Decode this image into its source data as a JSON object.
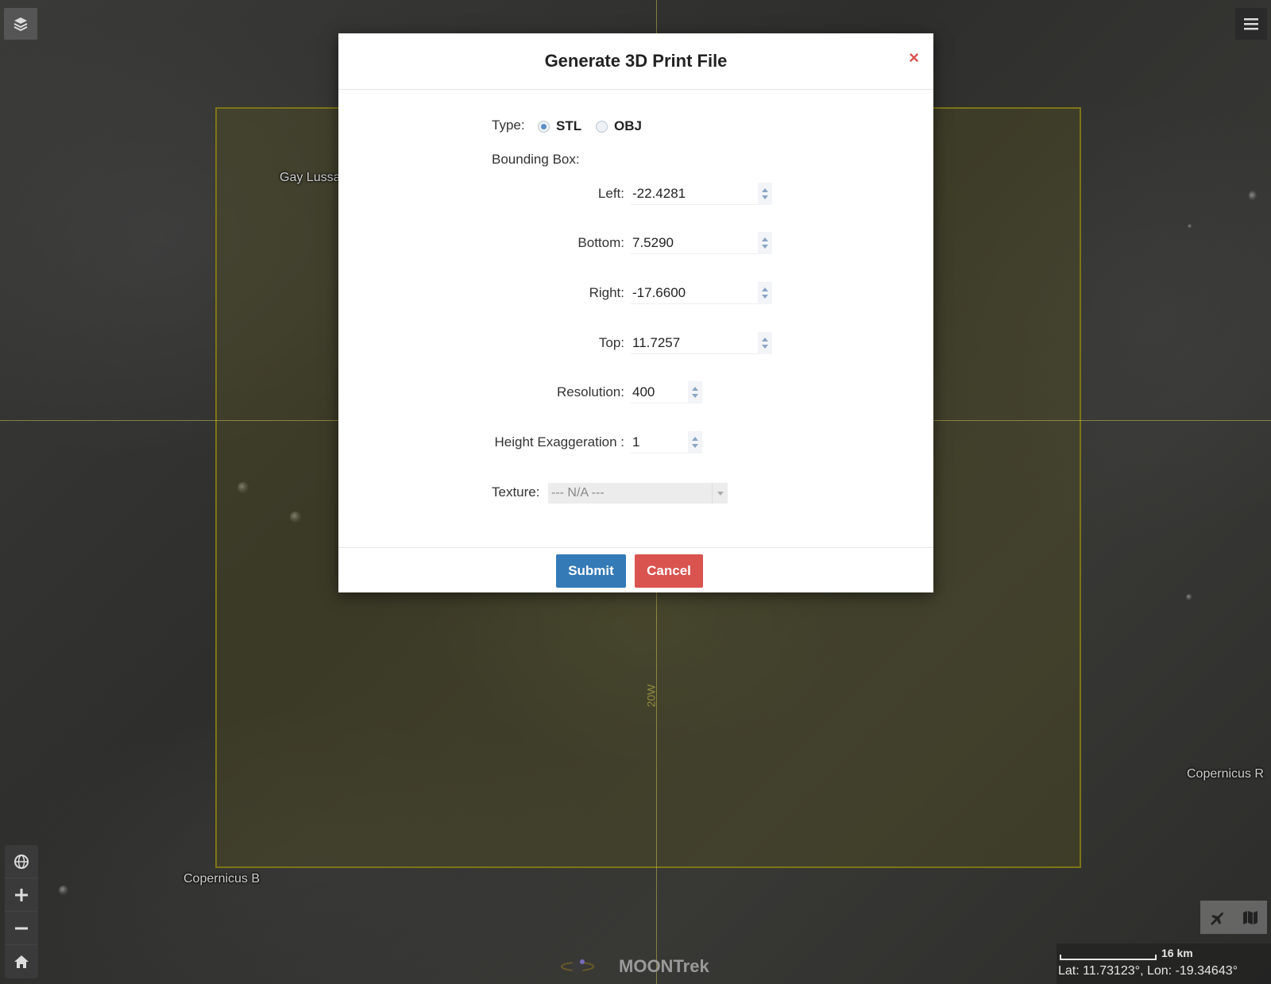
{
  "map": {
    "labels": {
      "gay_lussac": "Gay Lussac",
      "copernicus_b": "Copernicus B",
      "copernicus_r": "Copernicus R",
      "grid_lon": "20W"
    },
    "scale": {
      "text": "16 km"
    },
    "coords": "Lat: 11.73123°, Lon: -19.34643°",
    "logo": "MOONTrek"
  },
  "modal": {
    "title": "Generate 3D Print File",
    "close": "×",
    "type_label": "Type:",
    "type_options": [
      {
        "label": "STL",
        "checked": true
      },
      {
        "label": "OBJ",
        "checked": false
      }
    ],
    "bounding_box_label": "Bounding Box:",
    "fields": {
      "left": {
        "label": "Left:",
        "value": "-22.4281"
      },
      "bottom": {
        "label": "Bottom:",
        "value": "7.5290"
      },
      "right": {
        "label": "Right:",
        "value": "-17.6600"
      },
      "top": {
        "label": "Top:",
        "value": "11.7257"
      },
      "resolution": {
        "label": "Resolution:",
        "value": "400"
      },
      "height_exaggeration": {
        "label": "Height Exaggeration :",
        "value": "1"
      }
    },
    "texture": {
      "label": "Texture:",
      "value": "--- N/A ---"
    },
    "buttons": {
      "submit": "Submit",
      "cancel": "Cancel"
    }
  },
  "colors": {
    "submit": "#337ab7",
    "cancel": "#d9534f",
    "bbox": "#7d7518"
  },
  "icons": {
    "layers": "layers-icon",
    "menu": "hamburger-menu-icon",
    "globe": "globe-icon",
    "zoom_in": "plus-icon",
    "zoom_out": "minus-icon",
    "home": "home-icon",
    "fly": "airplane-icon",
    "map": "map-icon"
  }
}
